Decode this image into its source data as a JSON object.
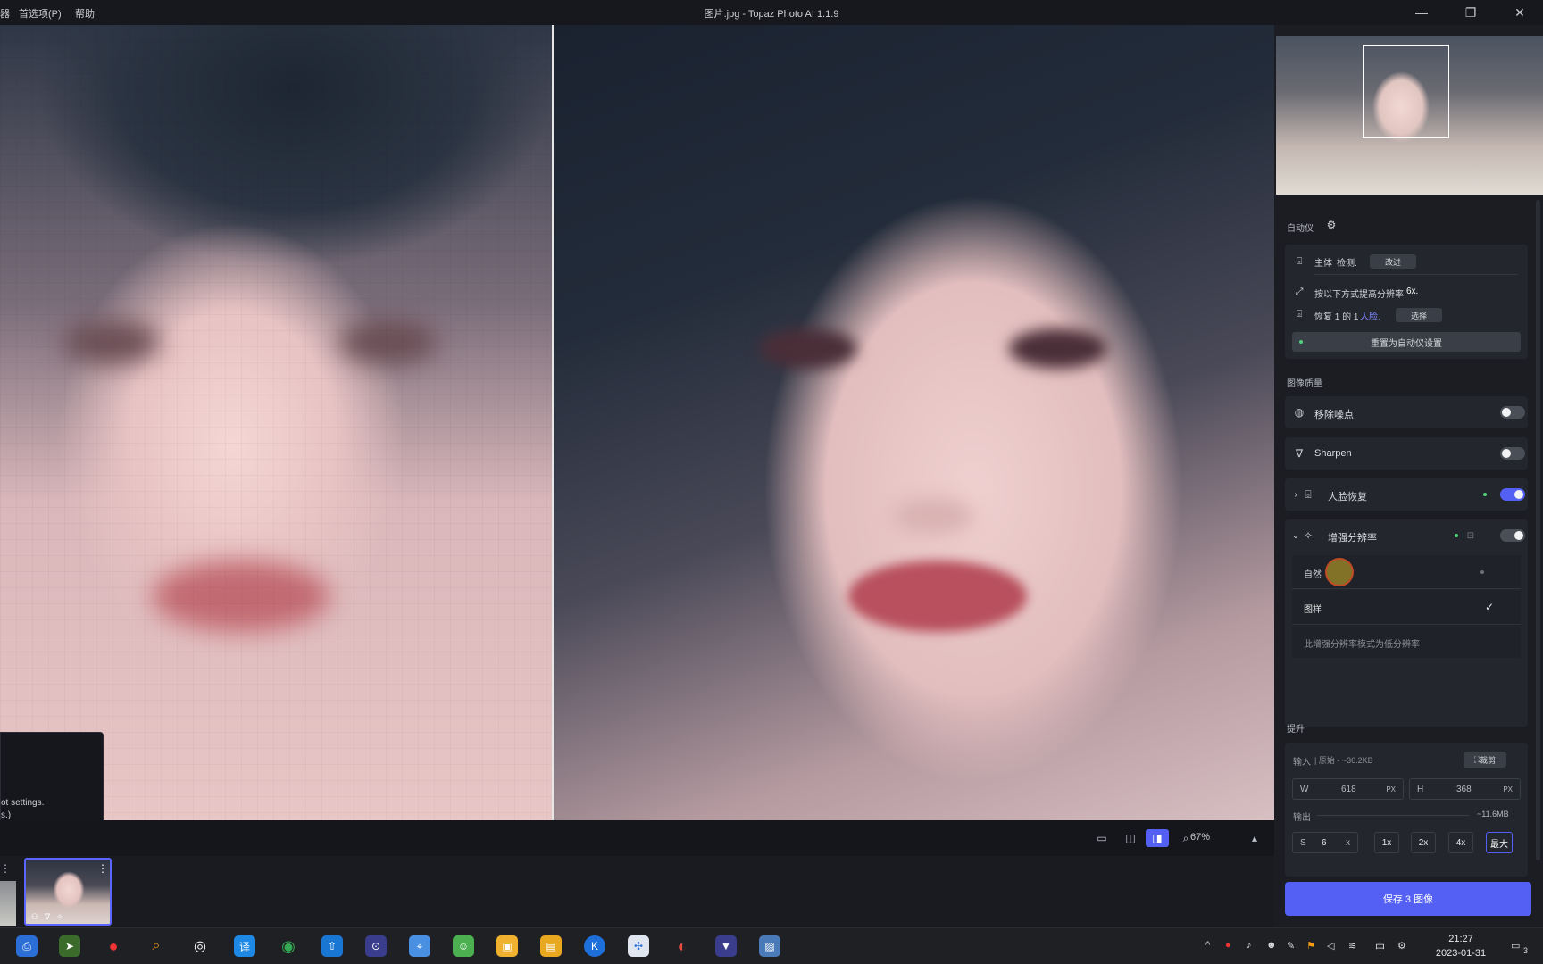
{
  "window": {
    "title": "图片.jpg - Topaz Photo AI 1.1.9",
    "menu": [
      "器",
      "首选项(P)",
      "帮助"
    ],
    "controls": {
      "minimize": "—",
      "restore": "❐",
      "close": "✕"
    }
  },
  "viewer": {
    "toast_line1": "ot settings.",
    "toast_line2": "s.)"
  },
  "viewbar": {
    "zoom_value": "67%",
    "modes": [
      "single-view-icon",
      "split-view-icon",
      "side-by-side-icon"
    ],
    "active_mode": "side-by-side-icon"
  },
  "sidebar": {
    "autopilot_label": "自动仪",
    "subject": {
      "prefix": "主体",
      "suffix": "检测.",
      "button": "改进"
    },
    "upscale_info": {
      "text": "按以下方式提高分辨率",
      "value": "6x."
    },
    "face_info": {
      "prefix": "恢复 1 的 1",
      "link": "人脸.",
      "button": "选择"
    },
    "reset_button": "重置为自动仪设置",
    "quality_label": "图像质量",
    "features": [
      {
        "label": "移除噪点",
        "state": "off"
      },
      {
        "label": "Sharpen",
        "state": "off"
      },
      {
        "label": "人脸恢复",
        "state": "on"
      },
      {
        "label": "增强分辨率",
        "state": "on-grey"
      }
    ],
    "enhance_options": {
      "option1": "自然",
      "option2": "图样",
      "hint": "此增强分辨率模式为低分辨率"
    },
    "upscale_label": "提升",
    "input": {
      "label": "输入",
      "meta": "| 原始 - ~36.2KB",
      "crop_button": "裁剪"
    },
    "dims": {
      "w_label": "W",
      "w_value": "618",
      "w_unit": "PX",
      "h_label": "H",
      "h_value": "368",
      "h_unit": "PX"
    },
    "output": {
      "label": "输出",
      "size": "~11.6MB"
    },
    "scale": {
      "s_label": "S",
      "s_value": "6",
      "s_unit": "x",
      "presets": [
        "1x",
        "2x",
        "4x",
        "最大"
      ],
      "active": "最大"
    },
    "save_button": "保存 3 图像"
  },
  "taskbar": {
    "time": "21:27",
    "date": "2023-01-31",
    "notif_count": "3",
    "ime": "中",
    "apps": [
      "printer-icon",
      "folder-arrow-icon",
      "record-icon",
      "search-app-icon",
      "aperture-icon",
      "translate-icon",
      "chrome-icon",
      "upload-icon",
      "lock-app-icon",
      "maps-icon",
      "panda-icon",
      "package-icon",
      "file-explorer-icon",
      "k-app-icon",
      "network-icon",
      "color-wheel-icon",
      "topaz-icon",
      "image-viewer-icon"
    ]
  },
  "colors": {
    "accent": "#5460f4",
    "panel": "#1b1d23",
    "card": "#23262d"
  }
}
